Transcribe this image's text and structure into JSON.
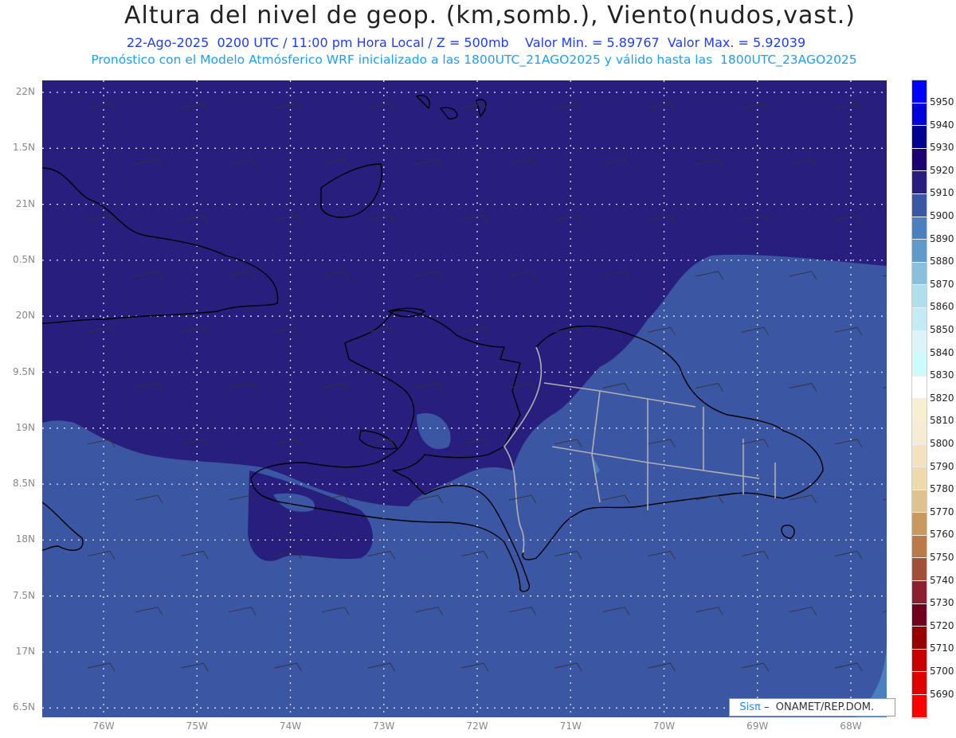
{
  "title": "Altura del nivel de geop. (km,somb.), Viento(nudos,vast.)",
  "subtitle": "22-Ago-2025  0200 UTC / 11:00 pm Hora Local / Z = 500mb    Valor Min. = 5.89767  Valor Max. = 5.92039",
  "model_line": "Pronóstico con el Modelo Atmósferico WRF inicializado a las 1800UTC_21AGO2025 y válido hasta las  1800UTC_23AGO2025",
  "lat_labels": [
    "22N",
    "1.5N",
    "21N",
    "0.5N",
    "20N",
    "9.5N",
    "19N",
    "8.5N",
    "18N",
    "7.5N",
    "17N",
    "6.5N"
  ],
  "lon_labels": [
    "76W",
    "75W",
    "74W",
    "73W",
    "72W",
    "71W",
    "70W",
    "69W",
    "68W"
  ],
  "colorbar": {
    "labels": [
      "5950",
      "5940",
      "5930",
      "5920",
      "5910",
      "5900",
      "5890",
      "5880",
      "5870",
      "5860",
      "5850",
      "5840",
      "5830",
      "5820",
      "5810",
      "5800",
      "5790",
      "5780",
      "5770",
      "5760",
      "5750",
      "5740",
      "5730",
      "5720",
      "5710",
      "5700",
      "5690"
    ],
    "colors": [
      "#0000ff",
      "#0000dd",
      "#000090",
      "#1a0070",
      "#271e7e",
      "#3b56a3",
      "#4a80bf",
      "#5f9acb",
      "#8bbfde",
      "#b0dfec",
      "#c4ebf3",
      "#dcf4f8",
      "#cdfafa",
      "#ffffff",
      "#f7efcf",
      "#f6ecd6",
      "#f2e3c0",
      "#eedaac",
      "#e0c190",
      "#c99a60",
      "#b97a48",
      "#a05038",
      "#8a2030",
      "#700020",
      "#960000",
      "#c80000",
      "#e00000",
      "#ff0000"
    ]
  },
  "logo": {
    "brand": "Sisπ",
    "text": " –  ONAMET/REP.DOM."
  }
}
